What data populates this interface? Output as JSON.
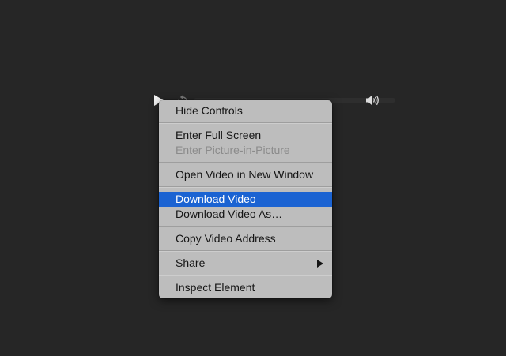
{
  "video_controls": {
    "play_icon": "play-icon",
    "rewind_icon": "rewind-icon",
    "volume_icon": "volume-icon"
  },
  "context_menu": {
    "items": [
      {
        "label": "Hide Controls",
        "enabled": true
      },
      {
        "label": "Enter Full Screen",
        "enabled": true
      },
      {
        "label": "Enter Picture-in-Picture",
        "enabled": false
      },
      {
        "label": "Open Video in New Window",
        "enabled": true
      },
      {
        "label": "Download Video",
        "enabled": true,
        "highlighted": true
      },
      {
        "label": "Download Video As…",
        "enabled": true
      },
      {
        "label": "Copy Video Address",
        "enabled": true
      },
      {
        "label": "Share",
        "enabled": true,
        "submenu": true
      },
      {
        "label": "Inspect Element",
        "enabled": true
      }
    ]
  },
  "colors": {
    "background": "#262626",
    "menu_background": "#bdbdbd",
    "highlight": "#1b63d2",
    "disabled_text": "#8b8b8b"
  }
}
